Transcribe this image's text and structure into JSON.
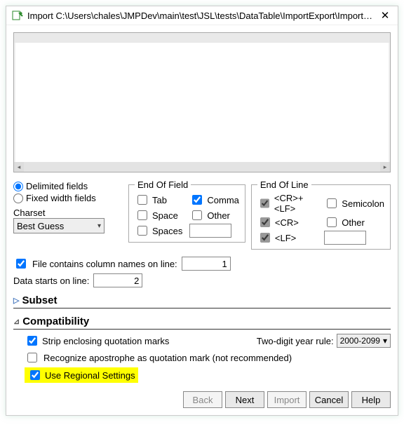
{
  "window": {
    "title": "Import C:\\Users\\chales\\JMPDev\\main\\test\\JSL\\tests\\DataTable\\ImportExport\\ImportData\\..."
  },
  "source": {
    "delimited_label": "Delimited fields",
    "fixed_label": "Fixed width fields",
    "charset_label": "Charset",
    "charset_value": "Best Guess"
  },
  "eof": {
    "legend": "End Of Field",
    "tab": "Tab",
    "comma": "Comma",
    "space": "Space",
    "other": "Other",
    "spaces": "Spaces",
    "other_value": ""
  },
  "eol": {
    "legend": "End Of Line",
    "crlf": "<CR>+<LF>",
    "semicolon": "Semicolon",
    "cr": "<CR>",
    "other": "Other",
    "lf": "<LF>",
    "other_value": ""
  },
  "lines": {
    "colnames_label": "File contains column names on line:",
    "colnames_value": "1",
    "data_label": "Data starts on line:",
    "data_value": "2"
  },
  "sections": {
    "subset": "Subset",
    "compat": "Compatibility"
  },
  "compat": {
    "strip": "Strip enclosing quotation marks",
    "twodigit_label": "Two-digit year rule:",
    "twodigit_value": "2000-2099",
    "apostrophe": "Recognize apostrophe as quotation mark (not recommended)",
    "regional": "Use Regional Settings"
  },
  "buttons": {
    "back": "Back",
    "next": "Next",
    "import": "Import",
    "cancel": "Cancel",
    "help": "Help"
  }
}
